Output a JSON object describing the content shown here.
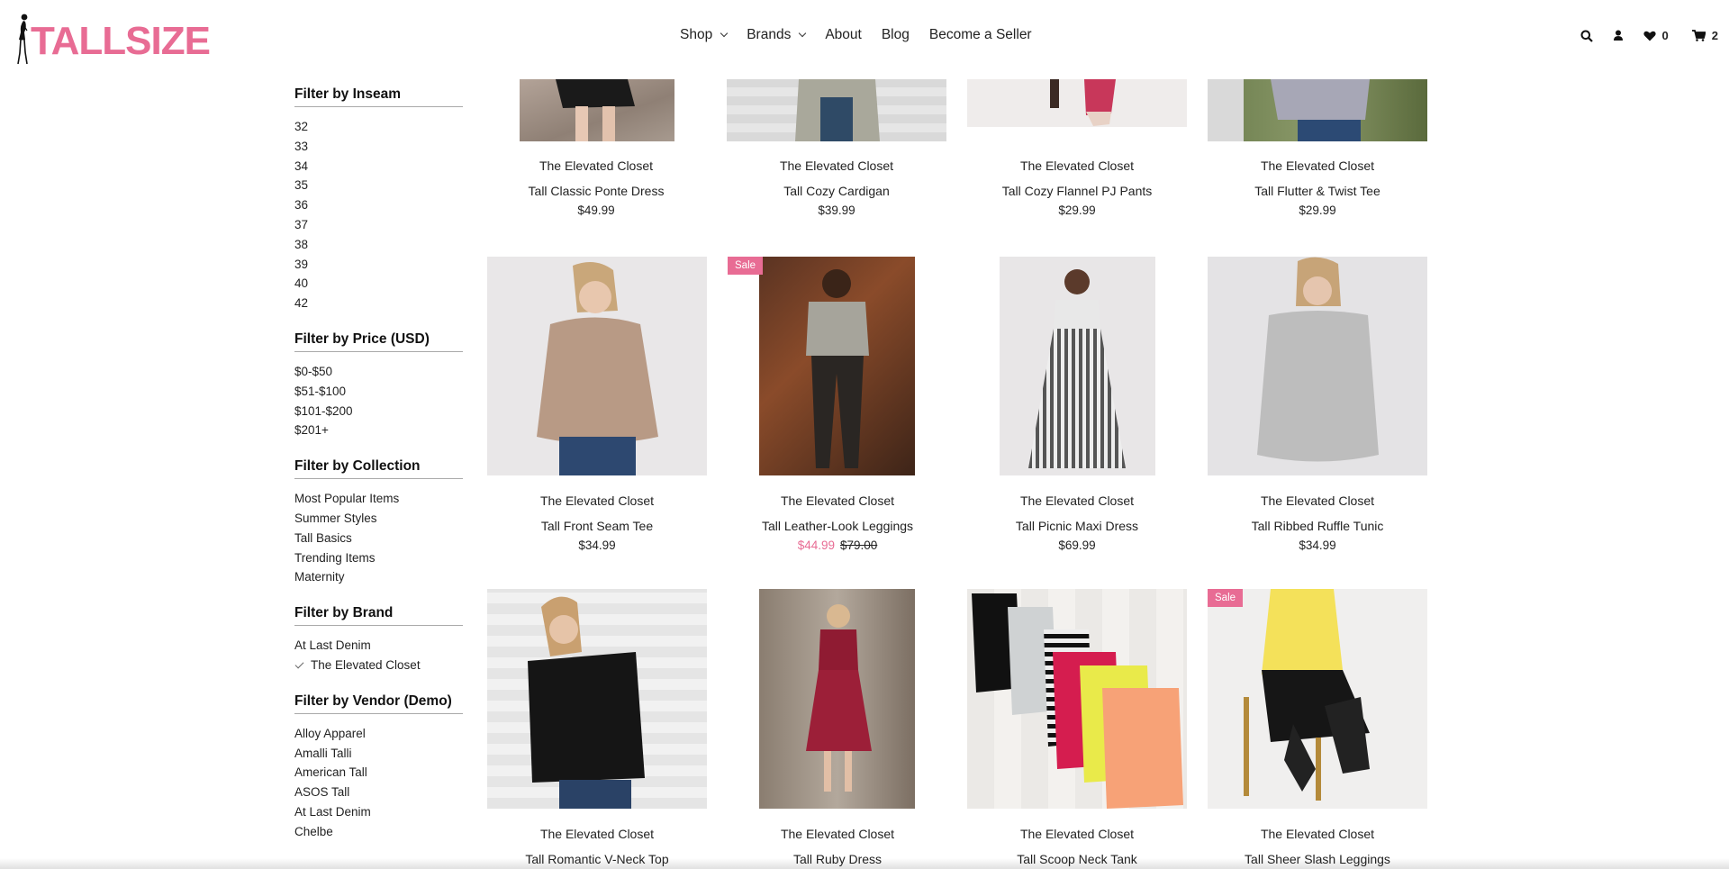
{
  "header": {
    "logo_text": "TALLSIZE",
    "nav": [
      {
        "label": "Shop",
        "dropdown": true
      },
      {
        "label": "Brands",
        "dropdown": true
      },
      {
        "label": "About",
        "dropdown": false
      },
      {
        "label": "Blog",
        "dropdown": false
      },
      {
        "label": "Become a Seller",
        "dropdown": false
      }
    ],
    "wishlist_count": "0",
    "cart_count": "2",
    "icons": [
      "search-icon",
      "user-icon",
      "heart-icon",
      "cart-icon"
    ]
  },
  "filters": {
    "inseam": {
      "title": "Filter by Inseam",
      "items": [
        "32",
        "33",
        "34",
        "35",
        "36",
        "37",
        "38",
        "39",
        "40",
        "42"
      ]
    },
    "price": {
      "title": "Filter by Price (USD)",
      "items": [
        "$0-$50",
        "$51-$100",
        "$101-$200",
        "$201+"
      ]
    },
    "collection": {
      "title": "Filter by Collection",
      "items": [
        "Most Popular Items",
        "Summer Styles",
        "Tall Basics",
        "Trending Items",
        "Maternity"
      ]
    },
    "brand": {
      "title": "Filter by Brand",
      "items": [
        "At Last Denim",
        "The Elevated Closet"
      ],
      "checked": "The Elevated Closet"
    },
    "vendor": {
      "title": "Filter by Vendor (Demo)",
      "items": [
        "Alloy Apparel",
        "Amalli Talli",
        "American Tall",
        "ASOS Tall",
        "At Last Denim",
        "Chelbe"
      ]
    }
  },
  "products": [
    {
      "brand": "The Elevated Closet",
      "name": "Tall Classic Ponte Dress",
      "price": "$49.99"
    },
    {
      "brand": "The Elevated Closet",
      "name": "Tall Cozy Cardigan",
      "price": "$39.99"
    },
    {
      "brand": "The Elevated Closet",
      "name": "Tall Cozy Flannel PJ Pants",
      "price": "$29.99"
    },
    {
      "brand": "The Elevated Closet",
      "name": "Tall Flutter & Twist Tee",
      "price": "$29.99"
    },
    {
      "brand": "The Elevated Closet",
      "name": "Tall Front Seam Tee",
      "price": "$34.99"
    },
    {
      "brand": "The Elevated Closet",
      "name": "Tall Leather-Look Leggings",
      "sale_price": "$44.99",
      "original_price": "$79.00",
      "badge": "Sale"
    },
    {
      "brand": "The Elevated Closet",
      "name": "Tall Picnic Maxi Dress",
      "price": "$69.99"
    },
    {
      "brand": "The Elevated Closet",
      "name": "Tall Ribbed Ruffle Tunic",
      "price": "$34.99"
    },
    {
      "brand": "The Elevated Closet",
      "name": "Tall Romantic V-Neck Top"
    },
    {
      "brand": "The Elevated Closet",
      "name": "Tall Ruby Dress"
    },
    {
      "brand": "The Elevated Closet",
      "name": "Tall Scoop Neck Tank"
    },
    {
      "brand": "The Elevated Closet",
      "name": "Tall Sheer Slash Leggings",
      "badge": "Sale"
    }
  ],
  "colors": {
    "accent": "#e86c94",
    "text": "#222222"
  }
}
